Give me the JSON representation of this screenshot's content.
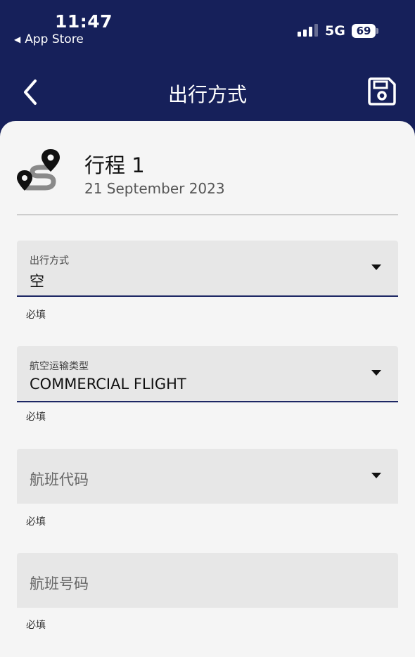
{
  "status_bar": {
    "time": "11:47",
    "back_app_label": "App Store",
    "network": "5G",
    "battery": "69"
  },
  "nav": {
    "title": "出行方式",
    "back_icon": "chevron-left-icon",
    "save_icon": "floppy-disk-icon"
  },
  "trip": {
    "title": "行程 1",
    "date": "21 September 2023",
    "icon": "route-pins-icon"
  },
  "fields": [
    {
      "label": "出行方式",
      "value": "空",
      "helper": "必填",
      "type": "select"
    },
    {
      "label": "航空运输类型",
      "value": "COMMERCIAL FLIGHT",
      "helper": "必填",
      "type": "select"
    },
    {
      "placeholder": "航班代码",
      "helper": "必填",
      "type": "select"
    },
    {
      "placeholder": "航班号码",
      "helper": "必填",
      "type": "text"
    }
  ],
  "colors": {
    "header_bg": "#16205a",
    "content_bg": "#f5f5f5",
    "field_bg": "#e7e7e7",
    "underline": "#1d2764"
  }
}
